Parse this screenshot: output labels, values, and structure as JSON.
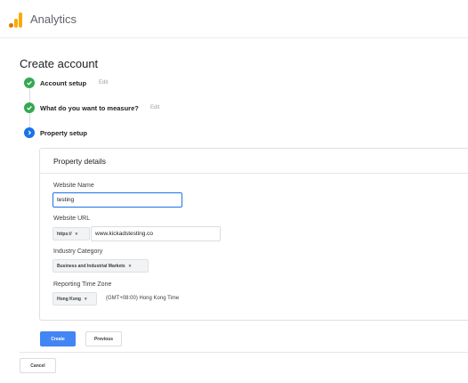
{
  "header": {
    "app_title": "Analytics",
    "logo_icon": "analytics-logo-icon"
  },
  "page": {
    "title": "Create account"
  },
  "steps": [
    {
      "label": "Account setup",
      "edit": "Edit",
      "state": "done"
    },
    {
      "label": "What do you want to measure?",
      "edit": "Edit",
      "state": "done"
    },
    {
      "label": "Property setup",
      "state": "active"
    }
  ],
  "property_details": {
    "title": "Property details",
    "website_name": {
      "label": "Website Name",
      "value": "testing"
    },
    "website_url": {
      "label": "Website URL",
      "protocol": "https://",
      "value": "www.kickadstesting.co"
    },
    "industry_category": {
      "label": "Industry Category",
      "selected": "Business and Industrial Markets"
    },
    "reporting_time_zone": {
      "label": "Reporting Time Zone",
      "country": "Hong Kong",
      "zone": "(GMT+08:00) Hong Kong Time"
    }
  },
  "actions": {
    "create": "Create",
    "previous": "Previous",
    "cancel": "Cancel"
  },
  "colors": {
    "primary": "#4285f4",
    "done": "#34a853",
    "active": "#1a73e8",
    "logo_dark": "#e37400",
    "logo_light": "#f9ab00"
  }
}
